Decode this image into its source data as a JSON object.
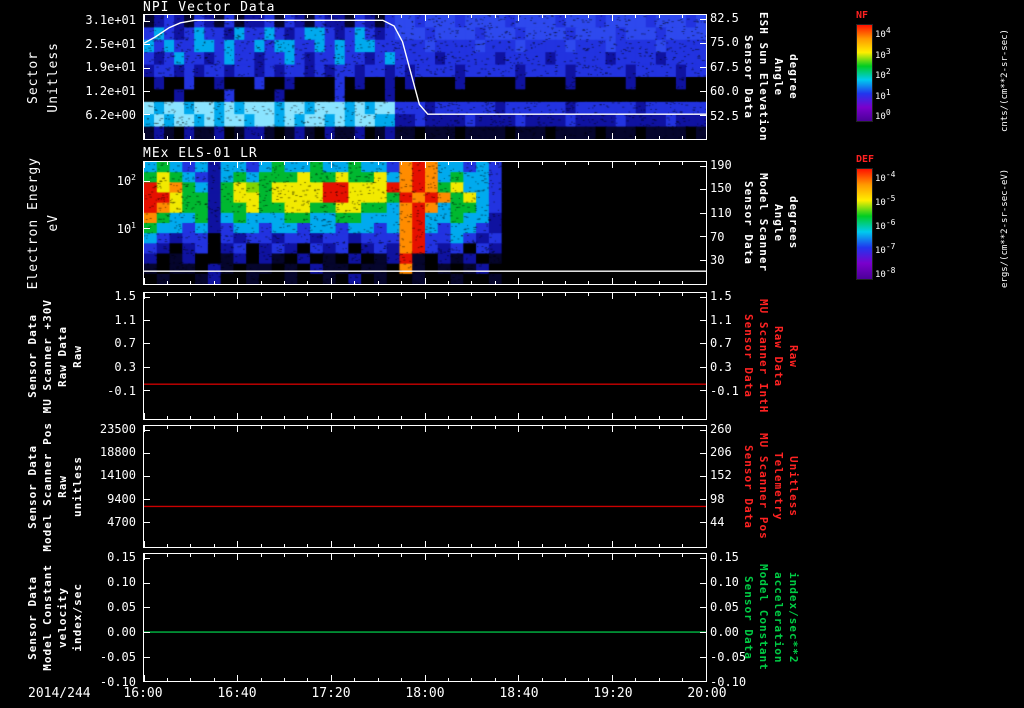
{
  "x_axis": {
    "date": "2014/244",
    "ticks": [
      "16:00",
      "16:40",
      "17:20",
      "18:00",
      "18:40",
      "19:20",
      "20:00"
    ]
  },
  "spec_palette": {
    "k": "#000000",
    "n": "#05052c",
    "d": "#0f12a0",
    "b": "#2233e0",
    "m": "#2e49ee",
    "c": "#00aaee",
    "C": "#8ae4ff",
    "g": "#00b830",
    "G": "#7fd400",
    "y": "#f2ea00",
    "o": "#ff8c00",
    "r": "#e61000"
  },
  "colorbars": {
    "nf": {
      "name": "NF",
      "units": "cnts/(cm**2-sr-sec)",
      "ticks": [
        "10^4",
        "10^3",
        "10^2",
        "10^1",
        "10^0"
      ],
      "gradient": [
        "#ff1100",
        "#ff9900",
        "#ffee00",
        "#00cc22",
        "#00cbee",
        "#2136ee",
        "#7a00cc",
        "#4b0099"
      ]
    },
    "def": {
      "name": "DEF",
      "units": "ergs/(cm**2-sr-sec-eV)",
      "ticks": [
        "10^-4",
        "10^-5",
        "10^-6",
        "10^-7",
        "10^-8"
      ],
      "gradient": [
        "#ff1100",
        "#ff9900",
        "#ffee00",
        "#00cc22",
        "#00cbee",
        "#2136ee",
        "#7a00cc",
        "#4b0099"
      ]
    }
  },
  "panels": [
    {
      "id": "p1",
      "title": "NPI Vector Data",
      "label_size": "lg",
      "left_label_lines": [
        "Sector",
        "Unitless"
      ],
      "left_label_color": "#ffffff",
      "right_label_lines": [
        "Sensor Data",
        "ESH Sun Elevation",
        "Angle",
        "degree"
      ],
      "right_label_color": "#ffffff",
      "left_ticks": [
        {
          "label": "3.1e+01",
          "frac": 0.048
        },
        {
          "label": "2.5e+01",
          "frac": 0.236
        },
        {
          "label": "1.9e+01",
          "frac": 0.424
        },
        {
          "label": "1.2e+01",
          "frac": 0.612
        },
        {
          "label": "6.2e+00",
          "frac": 0.8
        }
      ],
      "right_ticks": [
        {
          "label": "82.5",
          "frac": 0.03
        },
        {
          "label": "75.0",
          "frac": 0.225
        },
        {
          "label": "67.5",
          "frac": 0.42
        },
        {
          "label": "60.0",
          "frac": 0.615
        },
        {
          "label": "52.5",
          "frac": 0.81
        }
      ],
      "curve_from_chart": 0,
      "spectrogram": {
        "cols": 56,
        "rows": [
          "ndbdnbdnbnddbnbdnbddnbdnbmmbmmmbmmmmbmmmmbmmmbmmmmbmmmbm",
          "bcbdbcbbdcbbcbdbccbdbcbdbmmmbmmmmbmmmbmmmmbmmmmbmmmbmmmm",
          "cbcbbccbcbbcbccbbcbcbccbbbbbmbbbbmbbbmbbbbmbbbmbbbbmbbbb",
          "bdbcbbdbcbbdbbcbdbbcbbdbcbbbbdbbbbbdbbbbdbbbbbdbbbbdbbbb",
          "dbbdbdbbdbbdbdbbdbdbbdbbdbdbbbbdbbbbbdbbbbdbbbbbdbbbbdbb",
          "kdkkbkkdkkkbkkdkkkkbkdkkdkdkkkkdkkkkkdkkkkdkkkkkdkkkkdkk",
          "kkkdkkkkbkkkkdkkkkkbkkkkdkkkkkkkkkkkkkkkkkkkkkkkkkkkkkkk",
          "CcCCcCCcCcCCCcCCcCCCcCcCCbbbdbbbbbbdbbbbbbdbbbbbbdbbbbbb",
          "cCcCCcCcCCcCCcCcCCcCcCCccddbddddbddddbddddbddddbddddbddd",
          "ndnkdnndknddnkndnkdnndkndnnknnnknnnnknnnknnnnknnnknnnnkn"
        ]
      }
    },
    {
      "id": "p2",
      "title": "MEx ELS-01 LR",
      "label_size": "lg",
      "left_label_lines": [
        "Electron Energy",
        "eV"
      ],
      "left_label_color": "#ffffff",
      "right_label_lines": [
        "Sensor Data",
        "Model Scanner",
        "Angle",
        "degrees"
      ],
      "right_label_color": "#ffffff",
      "left_ticks": [
        {
          "label": "10^2",
          "frac": 0.153
        },
        {
          "label": "10^1",
          "frac": 0.54
        }
      ],
      "right_ticks": [
        {
          "label": "190",
          "frac": 0.03
        },
        {
          "label": "150",
          "frac": 0.22
        },
        {
          "label": "110",
          "frac": 0.42
        },
        {
          "label": "70",
          "frac": 0.61
        },
        {
          "label": "30",
          "frac": 0.8
        }
      ],
      "baseline_frac": 0.895,
      "baseline_color": "#ffffff",
      "spectrogram": {
        "cols": 44,
        "rows": [
          "cgcbcdccbcgccgccgccboroccbcbkkkkkkkkkkkkkkkk",
          "gygcbdcgcgggyggyggycorocgccbkkkkkkkkkkkkkkkk",
          "ryogcdgyGgyyyyrryyyrorogyccbkkkkkkkkkkkkkkkk",
          "rryggdgyygyyyyrryyygrorogycbkkkkkkkkkkkkkkkk",
          "royggdggyggyyggyyggcorocggcbkkkkkkkkkkkkkkkk",
          "ogccgdcgcccggccggcccorccgccdkkkkkkkkkkkkkkkk",
          "gccbcdbccbccbccbccbcorcbccbdkkkkkkkkkkkkkkkk",
          "cbdbbkbdbbdbbdbbdbbborbbcbdbkkkkkkkkkkkkkkkk",
          "bdkdbkdbkdbdkbdbkdbdorbdbkbdkkkkkkkkkkkkkkkk",
          "dkndkkndkdnkdknkdkndrnkdndknkkkkkkkkkkkkkkkk",
          "nknnkdnknnknkdnnknnkonknkndkkkkkkkkkkkkkkkk k",
          "knkkndkknkknkknkdknkknkknkknkkkkkkkkkkkkkkkk"
        ]
      }
    },
    {
      "id": "p3",
      "title": "",
      "left_label_lines": [
        "Sensor Data",
        "MU Scanner +30V",
        "Raw Data",
        "Raw"
      ],
      "left_label_color": "#ffffff",
      "right_label_lines": [
        "Sensor Data",
        "MU Scanner IntH",
        "Raw Data",
        "Raw"
      ],
      "right_label_color": "#ff2222",
      "left_ticks": [
        {
          "label": "1.5",
          "frac": 0.03
        },
        {
          "label": "1.1",
          "frac": 0.215
        },
        {
          "label": "0.7",
          "frac": 0.4
        },
        {
          "label": "0.3",
          "frac": 0.585
        },
        {
          "label": "-0.1",
          "frac": 0.77
        }
      ],
      "right_ticks": [
        {
          "label": "1.5",
          "frac": 0.03
        },
        {
          "label": "1.1",
          "frac": 0.215
        },
        {
          "label": "0.7",
          "frac": 0.4
        },
        {
          "label": "0.3",
          "frac": 0.585
        },
        {
          "label": "-0.1",
          "frac": 0.77
        }
      ],
      "yscale": {
        "v0": 1.565,
        "v1": -0.597
      },
      "chart_index": 2
    },
    {
      "id": "p4",
      "title": "",
      "left_label_lines": [
        "Sensor Data",
        "Model Scanner Pos",
        "Raw",
        "unitless"
      ],
      "left_label_color": "#ffffff",
      "right_label_lines": [
        "Sensor Data",
        "MU Scanner Pos",
        "Telemetry",
        "Unitless"
      ],
      "right_label_color": "#ff2222",
      "left_ticks": [
        {
          "label": "23500",
          "frac": 0.03
        },
        {
          "label": "18800",
          "frac": 0.22
        },
        {
          "label": "14100",
          "frac": 0.41
        },
        {
          "label": "9400",
          "frac": 0.6
        },
        {
          "label": "4700",
          "frac": 0.79
        }
      ],
      "right_ticks": [
        {
          "label": "260",
          "frac": 0.03
        },
        {
          "label": "206",
          "frac": 0.22
        },
        {
          "label": "152",
          "frac": 0.41
        },
        {
          "label": "98",
          "frac": 0.6
        },
        {
          "label": "44",
          "frac": 0.79
        }
      ],
      "yscale": {
        "v0": 24242,
        "v1": -495
      },
      "chart_index": 3
    },
    {
      "id": "p5",
      "title": "",
      "left_label_lines": [
        "Sensor Data",
        "Model Constant",
        "velocity",
        "index/sec"
      ],
      "left_label_color": "#ffffff",
      "right_label_lines": [
        "Sensor Data",
        "Model Constant",
        "acceleration",
        "index/sec**2"
      ],
      "right_label_color": "#00cc44",
      "left_ticks": [
        {
          "label": "0.15",
          "frac": 0.03
        },
        {
          "label": "0.10",
          "frac": 0.225
        },
        {
          "label": "0.05",
          "frac": 0.42
        },
        {
          "label": "0.00",
          "frac": 0.615
        },
        {
          "label": "-0.05",
          "frac": 0.81
        },
        {
          "label": "-0.10",
          "frac": 1.0
        }
      ],
      "right_ticks": [
        {
          "label": "0.15",
          "frac": 0.03
        },
        {
          "label": "0.10",
          "frac": 0.225
        },
        {
          "label": "0.05",
          "frac": 0.42
        },
        {
          "label": "0.00",
          "frac": 0.615
        },
        {
          "label": "-0.05",
          "frac": 0.81
        },
        {
          "label": "-0.10",
          "frac": 1.0
        }
      ],
      "yscale": {
        "v0": 0.1577,
        "v1": -0.0987
      },
      "chart_index": 4
    }
  ],
  "chart_data": [
    {
      "type": "heatmap",
      "title": "NPI Vector Data",
      "x_date": "2014/244",
      "x_range": [
        "16:00",
        "20:00"
      ],
      "ylabel": "Sector (Unitless)",
      "y_ticks": [
        "3.1e+01",
        "2.5e+01",
        "1.9e+01",
        "1.2e+01",
        "6.2e+00"
      ],
      "colorbar": {
        "name": "NF",
        "units": "cnts/(cm**2-sr-sec)"
      },
      "right_axis": {
        "label": "Sensor Data ESH Sun Elevation Angle (degree)",
        "ticks": [
          82.5,
          75.0,
          67.5,
          60.0,
          52.5
        ]
      },
      "overlay_line": {
        "name": "ESH Sun Elevation Angle",
        "units": "degree",
        "scale": {
          "v_top": 84.5,
          "v_range": 39.5,
          "t_span_hours": 4
        },
        "points": [
          [
            0,
            75.5
          ],
          [
            0.08,
            77.5
          ],
          [
            0.18,
            80.5
          ],
          [
            0.26,
            82.0
          ],
          [
            0.36,
            82.8
          ],
          [
            1.7,
            82.8
          ],
          [
            1.78,
            81.0
          ],
          [
            1.84,
            76.0
          ],
          [
            1.9,
            66.0
          ],
          [
            1.96,
            56.0
          ],
          [
            2.02,
            52.9
          ],
          [
            4.0,
            52.9
          ]
        ]
      },
      "description": "Ion counts spectrogram: structured blue/cyan counts with dark band near sector 12 and bright cyan band near sectors 6-9 before ~17:50; dimmer uniform blue after 18:00"
    },
    {
      "type": "heatmap",
      "title": "MEx ELS-01 LR",
      "x_range": [
        "16:00",
        "20:00"
      ],
      "ylabel": "Electron Energy (eV)",
      "y_scale": "log",
      "y_ticks": [
        "10^2",
        "10^1"
      ],
      "colorbar": {
        "name": "DEF",
        "units": "ergs/(cm**2-sr-sec-eV)"
      },
      "right_axis": {
        "label": "Sensor Data Model Scanner Angle (degrees)",
        "ticks": [
          190,
          150,
          110,
          70,
          30
        ]
      },
      "coverage": "data 16:00-18:30, no data 18:30-20:00",
      "features": [
        "intense (red) electron flux 20-100 eV near 16:00-16:10",
        "broad yellow-green band 30-100 eV from ~16:50-17:40",
        "intense vertical enhancement spanning all energies ~17:50-18:00",
        "dark low fluxes below ~8 eV"
      ]
    },
    {
      "type": "line",
      "ylabel": "Sensor Data MU Scanner +30V Raw Data (Raw)",
      "right_ylabel": "Sensor Data MU Scanner IntH Raw Data (Raw)",
      "y_ticks": [
        1.5,
        1.1,
        0.7,
        0.3,
        -0.1
      ],
      "right_y_ticks": [
        1.5,
        1.1,
        0.7,
        0.3,
        -0.1
      ],
      "x_range": [
        "16:00",
        "20:00"
      ],
      "series": [
        {
          "name": "MU Scanner +30V Raw",
          "constant_value": 0.0,
          "color": "#cc0000"
        }
      ]
    },
    {
      "type": "line",
      "ylabel": "Sensor Data Model Scanner Pos Raw (unitless)",
      "right_ylabel": "Sensor Data MU Scanner Pos Telemetry (Unitless)",
      "y_ticks": [
        23500,
        18800,
        14100,
        9400,
        4700
      ],
      "right_y_ticks": [
        260,
        206,
        152,
        98,
        44
      ],
      "x_range": [
        "16:00",
        "20:00"
      ],
      "series": [
        {
          "name": "Model Scanner Pos Raw",
          "constant_value": 7800,
          "color": "#cc0000"
        }
      ]
    },
    {
      "type": "line",
      "ylabel": "Sensor Data Model Constant velocity (index/sec)",
      "right_ylabel": "Sensor Data Model Constant acceleration (index/sec**2)",
      "y_ticks": [
        0.15,
        0.1,
        0.05,
        0.0,
        -0.05,
        -0.1
      ],
      "right_y_ticks": [
        0.15,
        0.1,
        0.05,
        0.0,
        -0.05,
        -0.1
      ],
      "x_range": [
        "16:00",
        "20:00"
      ],
      "series": [
        {
          "name": "Model Constant velocity",
          "constant_value": 0.0,
          "color": "#00bb44"
        }
      ]
    }
  ]
}
